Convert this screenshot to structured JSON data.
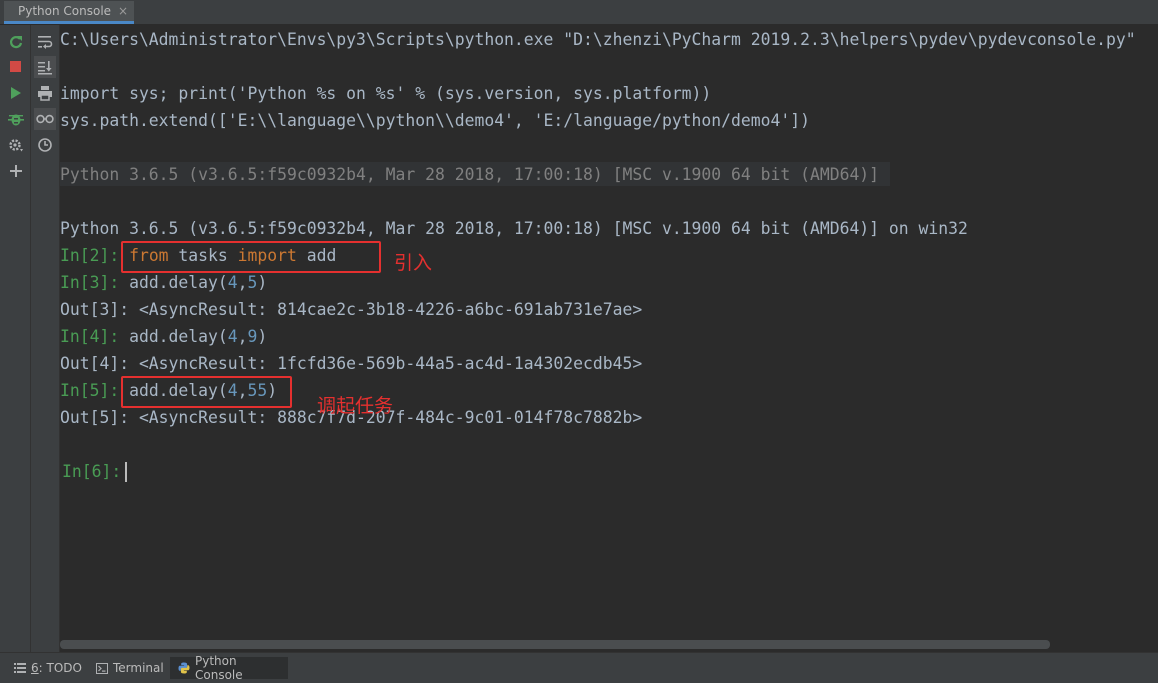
{
  "tab": {
    "title": "Python Console",
    "close": "×"
  },
  "left_toolbar": [
    {
      "icon": "rerun-icon",
      "color": "#4fa05c"
    },
    {
      "icon": "stop-icon",
      "color": "#d24a45"
    },
    {
      "icon": "run-icon",
      "color": "#4fa05c"
    },
    {
      "icon": "debug-icon",
      "color": "#4fa05c"
    },
    {
      "icon": "settings-icon"
    },
    {
      "icon": "add-icon"
    }
  ],
  "right_toolbar": [
    {
      "icon": "soft-wrap-icon"
    },
    {
      "icon": "scroll-to-end-icon"
    },
    {
      "icon": "print-icon"
    },
    {
      "icon": "show-variables-icon"
    },
    {
      "icon": "history-icon"
    }
  ],
  "console": {
    "cmd_line": "C:\\Users\\Administrator\\Envs\\py3\\Scripts\\python.exe \"D:\\zhenzi\\PyCharm 2019.2.3\\helpers\\pydev\\pydevconsole.py\"",
    "import_line": "import sys; print('Python %s on %s' % (sys.version, sys.platform))",
    "extend_line": "sys.path.extend(['E:\\\\language\\\\python\\\\demo4', 'E:/language/python/demo4'])",
    "sys_info": "Python 3.6.5 (v3.6.5:f59c0932b4, Mar 28 2018, 17:00:18) [MSC v.1900 64 bit (AMD64)]",
    "banner": "Python 3.6.5 (v3.6.5:f59c0932b4, Mar 28 2018, 17:00:18) [MSC v.1900 64 bit (AMD64)] on win32",
    "in2": {
      "prompt": "In[2]: ",
      "kw1": "from",
      "mid": " tasks ",
      "kw2": "import",
      "tail": " add"
    },
    "in3": {
      "prompt": "In[3]: ",
      "code": "add.delay(",
      "a": "4",
      "comma": ",",
      "b": "5",
      "close": ")"
    },
    "out3": "Out[3]: <AsyncResult: 814cae2c-3b18-4226-a6bc-691ab731e7ae>",
    "in4": {
      "prompt": "In[4]: ",
      "code": "add.delay(",
      "a": "4",
      "comma": ",",
      "b": "9",
      "close": ")"
    },
    "out4": "Out[4]: <AsyncResult: 1fcfd36e-569b-44a5-ac4d-1a4302ecdb45>",
    "in5": {
      "prompt": "In[5]: ",
      "code": "add.delay(",
      "a": "4",
      "comma": ",",
      "b": "55",
      "close": ")"
    },
    "out5": "Out[5]: <AsyncResult: 888c7f7d-207f-484c-9c01-014f78c7882b>",
    "in6": {
      "prompt": "In[6]:"
    }
  },
  "annotations": {
    "import_note": "引入",
    "task_note": "调起任务",
    "color": "#e5302f"
  },
  "bottom_tabs": [
    {
      "label_num": "6",
      "label": ": TODO",
      "icon": "todo-list-icon"
    },
    {
      "label": "Terminal",
      "icon": "terminal-icon"
    },
    {
      "label": "Python Console",
      "icon": "python-icon",
      "active": true
    }
  ]
}
